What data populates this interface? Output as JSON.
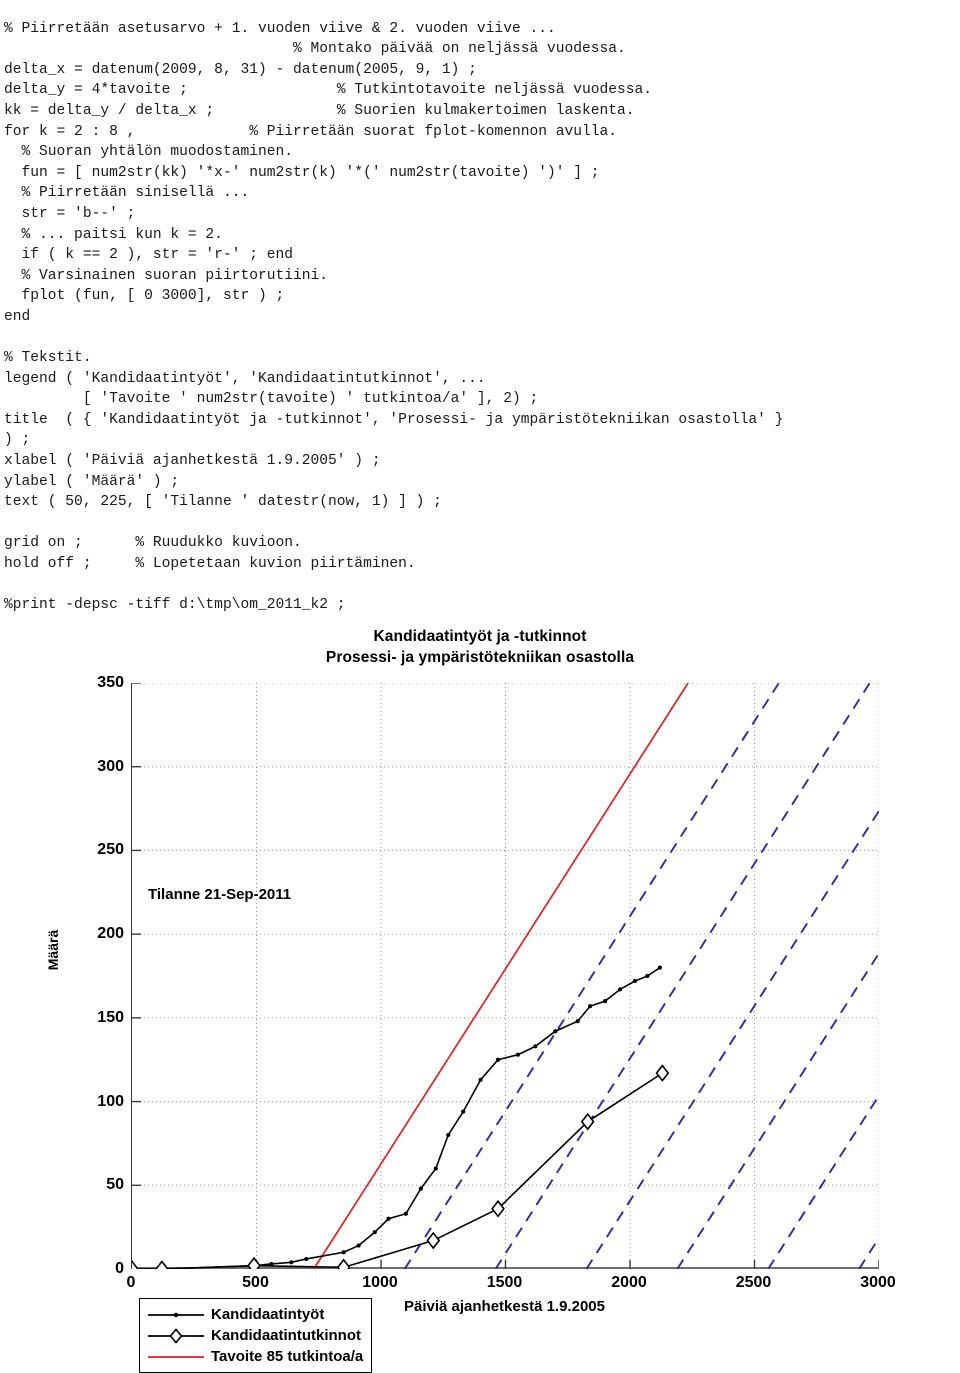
{
  "code": {
    "lines": [
      "% Piirretään asetusarvo + 1. vuoden viive & 2. vuoden viive ...",
      "                                 % Montako päivää on neljässä vuodessa.",
      "delta_x = datenum(2009, 8, 31) - datenum(2005, 9, 1) ;",
      "delta_y = 4*tavoite ;                 % Tutkintotavoite neljässä vuodessa.",
      "kk = delta_y / delta_x ;              % Suorien kulmakertoimen laskenta.",
      "for k = 2 : 8 ,             % Piirretään suorat fplot-komennon avulla.",
      "  % Suoran yhtälön muodostaminen.",
      "  fun = [ num2str(kk) '*x-' num2str(k) '*(' num2str(tavoite) ')' ] ;",
      "  % Piirretään sinisellä ...",
      "  str = 'b--' ;",
      "  % ... paitsi kun k = 2.",
      "  if ( k == 2 ), str = 'r-' ; end",
      "  % Varsinainen suoran piirtorutiini.",
      "  fplot (fun, [ 0 3000], str ) ;",
      "end",
      "",
      "% Tekstit.",
      "legend ( 'Kandidaatintyöt', 'Kandidaatintutkinnot', ...",
      "         [ 'Tavoite ' num2str(tavoite) ' tutkintoa/a' ], 2) ;",
      "title  ( { 'Kandidaatintyöt ja -tutkinnot', 'Prosessi- ja ympäristötekniikan osastolla' }",
      ") ;",
      "xlabel ( 'Päiviä ajanhetkestä 1.9.2005' ) ;",
      "ylabel ( 'Määrä' ) ;",
      "text ( 50, 225, [ 'Tilanne ' datestr(now, 1) ] ) ;",
      "",
      "grid on ;      % Ruudukko kuvioon.",
      "hold off ;     % Lopetetaan kuvion piirtäminen.",
      "",
      "%print -depsc -tiff d:\\tmp\\om_2011_k2 ;"
    ]
  },
  "chart_data": {
    "type": "line",
    "title": "Kandidaatintyöt ja -tutkinnot",
    "subtitle": "Prosessi- ja ympäristötekniikan osastolla",
    "xlabel": "Päiviä ajanhetkestä 1.9.2005",
    "ylabel": "Määrä",
    "xlim": [
      0,
      3000
    ],
    "ylim": [
      0,
      350
    ],
    "xticks": [
      0,
      500,
      1000,
      1500,
      2000,
      2500,
      3000
    ],
    "yticks": [
      0,
      50,
      100,
      150,
      200,
      250,
      300,
      350
    ],
    "grid": true,
    "legend_position": "upper left (2)",
    "annotations": [
      {
        "name": "status-note",
        "text": "Tilanne 21-Sep-2011",
        "x": 50,
        "y": 225
      }
    ],
    "colors": {
      "series_black": "#000000",
      "target_red": "#e02020",
      "target_blue": "#2b2ba0",
      "grid": "#9b9b9b",
      "axis": "#6e6e6e"
    },
    "series": [
      {
        "name": "Kandidaatintyöt",
        "legend_label": "Kandidaatintyöt",
        "color": "#000000",
        "marker": "dot",
        "style": "solid",
        "points": [
          [
            0,
            0
          ],
          [
            120,
            0
          ],
          [
            490,
            2
          ],
          [
            560,
            3
          ],
          [
            640,
            4
          ],
          [
            700,
            6
          ],
          [
            850,
            10
          ],
          [
            910,
            14
          ],
          [
            975,
            22
          ],
          [
            1030,
            30
          ],
          [
            1100,
            33
          ],
          [
            1160,
            48
          ],
          [
            1220,
            60
          ],
          [
            1270,
            80
          ],
          [
            1330,
            94
          ],
          [
            1400,
            113
          ],
          [
            1470,
            125
          ],
          [
            1550,
            128
          ],
          [
            1620,
            133
          ],
          [
            1700,
            142
          ],
          [
            1790,
            148
          ],
          [
            1840,
            157
          ],
          [
            1900,
            160
          ],
          [
            1960,
            167
          ],
          [
            2020,
            172
          ],
          [
            2070,
            175
          ],
          [
            2120,
            180
          ]
        ]
      },
      {
        "name": "Kandidaatintutkinnot",
        "legend_label": "Kandidaatintutkinnot",
        "color": "#000000",
        "marker": "diamond",
        "style": "solid",
        "points": [
          [
            0,
            0
          ],
          [
            120,
            0
          ],
          [
            490,
            2
          ],
          [
            850,
            1
          ],
          [
            1210,
            17
          ],
          [
            1470,
            36
          ],
          [
            1830,
            88
          ],
          [
            2130,
            117
          ]
        ]
      },
      {
        "name": "Tavoite 85 tutkintoa/a",
        "legend_label": "Tavoite 85 tutkintoa/a",
        "color": "#e02020",
        "style": "solid",
        "equation": "y = 0.2329*x - 2*85",
        "slope": 0.23288,
        "intercept": -170
      },
      {
        "name": "Tavoite viive k=3",
        "color": "#2b2ba0",
        "style": "dashed",
        "slope": 0.23288,
        "intercept": -255
      },
      {
        "name": "Tavoite viive k=4",
        "color": "#2b2ba0",
        "style": "dashed",
        "slope": 0.23288,
        "intercept": -340
      },
      {
        "name": "Tavoite viive k=5",
        "color": "#2b2ba0",
        "style": "dashed",
        "slope": 0.23288,
        "intercept": -425
      },
      {
        "name": "Tavoite viive k=6",
        "color": "#2b2ba0",
        "style": "dashed",
        "slope": 0.23288,
        "intercept": -510
      },
      {
        "name": "Tavoite viive k=7",
        "color": "#2b2ba0",
        "style": "dashed",
        "slope": 0.23288,
        "intercept": -595
      },
      {
        "name": "Tavoite viive k=8",
        "color": "#2b2ba0",
        "style": "dashed",
        "slope": 0.23288,
        "intercept": -680
      }
    ]
  },
  "legend": {
    "items": [
      {
        "label": "Kandidaatintyöt",
        "marker": "dot",
        "color": "#000000"
      },
      {
        "label": "Kandidaatintutkinnot",
        "marker": "diamond",
        "color": "#000000"
      },
      {
        "label": "Tavoite 85 tutkintoa/a",
        "marker": "none",
        "color": "#e02020"
      }
    ]
  }
}
